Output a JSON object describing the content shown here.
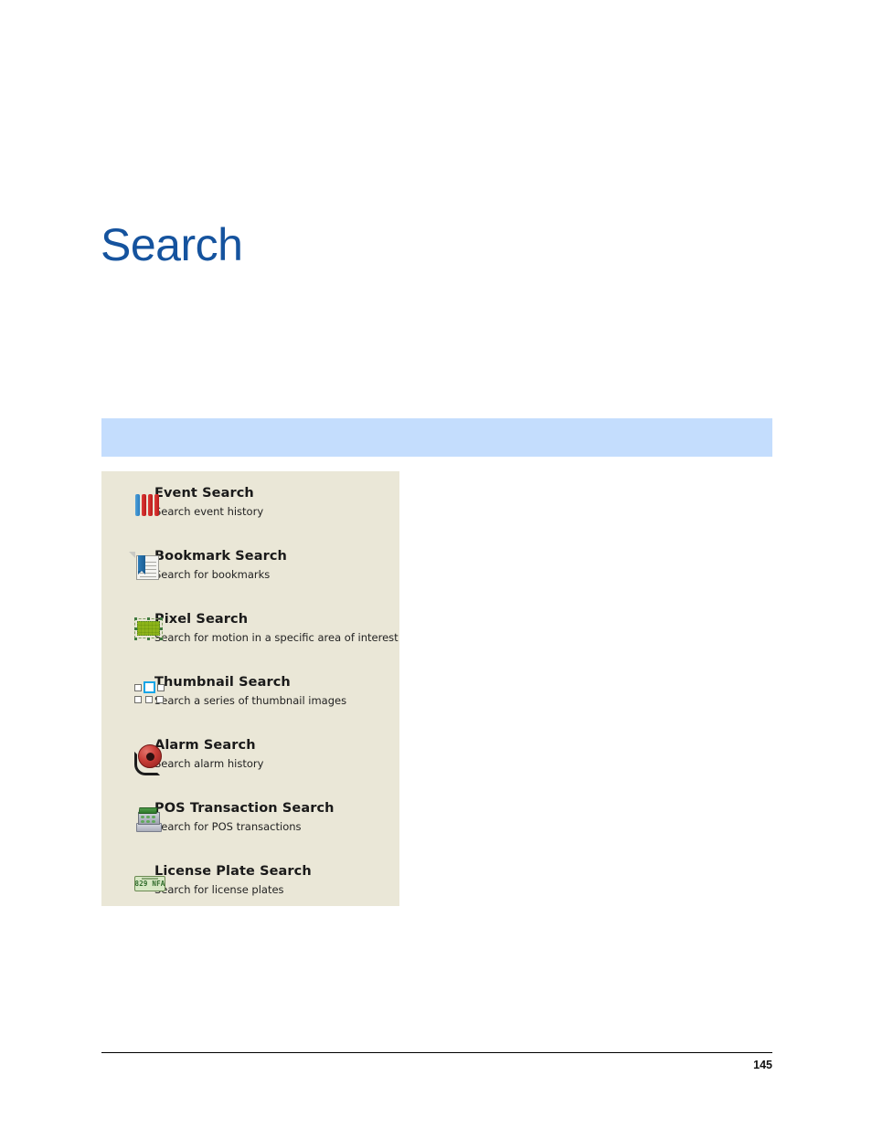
{
  "page": {
    "title": "Search",
    "page_number": "145",
    "title_color": "#15539e",
    "banner_color": "#c4ddfd",
    "panel_color": "#eae7d7",
    "banner_text": ""
  },
  "menu": {
    "items": [
      {
        "icon": "event-bars-icon",
        "title": "Event Search",
        "desc": "Search event history"
      },
      {
        "icon": "bookmark-page-icon",
        "title": "Bookmark Search",
        "desc": "Search for bookmarks"
      },
      {
        "icon": "pixel-region-icon",
        "title": "Pixel Search",
        "desc": "Search for motion in a specific area of interest"
      },
      {
        "icon": "thumbnail-grid-icon",
        "title": "Thumbnail Search",
        "desc": "Search a series of thumbnail images"
      },
      {
        "icon": "alarm-bell-icon",
        "title": "Alarm Search",
        "desc": "Search alarm history"
      },
      {
        "icon": "cash-register-icon",
        "title": "POS Transaction Search",
        "desc": "Search for POS transactions"
      },
      {
        "icon": "license-plate-icon",
        "title": "License Plate Search",
        "desc": "Search for license plates",
        "plate_text": "829 NFA"
      }
    ]
  }
}
